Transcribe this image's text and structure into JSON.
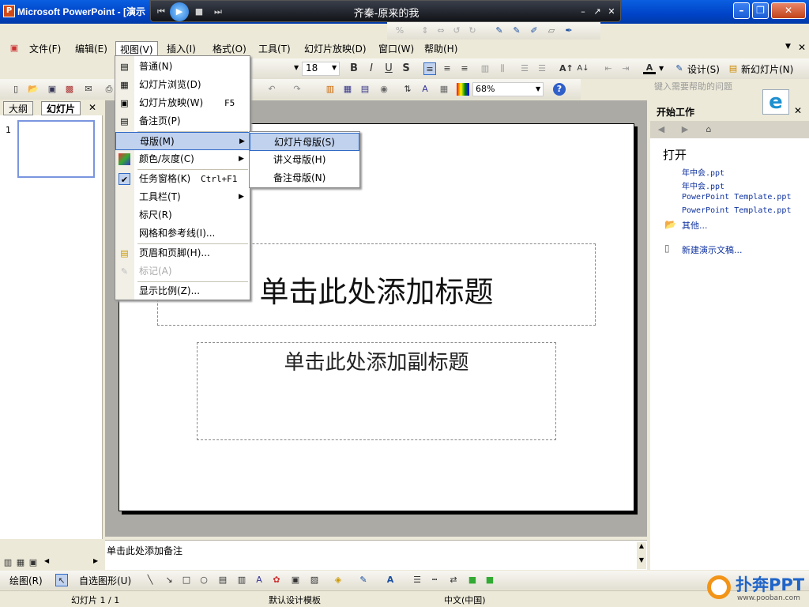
{
  "window": {
    "app_title": "Microsoft PowerPoint - [演示"
  },
  "player": {
    "song": "齐秦-原来的我",
    "prev": "⏮",
    "play": "▶",
    "stop": "■",
    "next": "⏭"
  },
  "title_buttons": {
    "min": "–",
    "restore": "❐",
    "close": "✕"
  },
  "player_buttons": {
    "min": "–",
    "max": "↗",
    "close": "✕"
  },
  "menubar": {
    "items": [
      {
        "label": "文件(F)"
      },
      {
        "label": "编辑(E)"
      },
      {
        "label": "视图(V)"
      },
      {
        "label": "插入(I)"
      },
      {
        "label": "格式(O)"
      },
      {
        "label": "工具(T)"
      },
      {
        "label": "幻灯片放映(D)"
      },
      {
        "label": "窗口(W)"
      },
      {
        "label": "帮助(H)"
      }
    ],
    "help_placeholder": "键入需要帮助的问题",
    "close": "✕"
  },
  "format_toolbar": {
    "font_size": "18",
    "bold": "B",
    "italic": "I",
    "underline": "U",
    "shadow": "S",
    "design_label": "设计(S)",
    "new_slide_label": "新幻灯片(N)"
  },
  "standard_toolbar": {
    "zoom": "68%"
  },
  "tabs": {
    "outline": "大纲",
    "slides": "幻灯片",
    "close": "✕"
  },
  "slides_pane": {
    "slide_number": "1"
  },
  "slide": {
    "title_placeholder": "单击此处添加标题",
    "subtitle_placeholder": "单击此处添加副标题"
  },
  "notes": {
    "placeholder": "单击此处添加备注"
  },
  "task_pane": {
    "title": "开始工作",
    "close": "✕",
    "section_open": "打开",
    "recent_files": [
      "年中会.ppt",
      "年中会.ppt",
      "PowerPoint Template.ppt",
      "PowerPoint Template.ppt"
    ],
    "more": "其他...",
    "new_presentation": "新建演示文稿..."
  },
  "view_menu": {
    "items": [
      {
        "label": "普通(N)",
        "shortcut": "",
        "icon": "normal-view-icon"
      },
      {
        "label": "幻灯片浏览(D)",
        "shortcut": "",
        "icon": "slide-sorter-icon"
      },
      {
        "label": "幻灯片放映(W)",
        "shortcut": "F5",
        "icon": "slideshow-icon"
      },
      {
        "label": "备注页(P)",
        "shortcut": "",
        "icon": "notes-page-icon"
      },
      {
        "label": "母版(M)",
        "shortcut": "",
        "icon": ""
      },
      {
        "label": "颜色/灰度(C)",
        "shortcut": "",
        "icon": "color-gray-icon"
      },
      {
        "label": "任务窗格(K)",
        "shortcut": "Ctrl+F1",
        "icon": "check-icon"
      },
      {
        "label": "工具栏(T)",
        "shortcut": "",
        "icon": ""
      },
      {
        "label": "标尺(R)",
        "shortcut": "",
        "icon": ""
      },
      {
        "label": "网格和参考线(I)...",
        "shortcut": "",
        "icon": ""
      },
      {
        "label": "页眉和页脚(H)...",
        "shortcut": "",
        "icon": "header-footer-icon"
      },
      {
        "label": "标记(A)",
        "shortcut": "",
        "icon": "markup-icon"
      },
      {
        "label": "显示比例(Z)...",
        "shortcut": "",
        "icon": ""
      }
    ]
  },
  "master_submenu": {
    "items": [
      {
        "label": "幻灯片母版(S)"
      },
      {
        "label": "讲义母版(H)"
      },
      {
        "label": "备注母版(N)"
      }
    ]
  },
  "draw_toolbar": {
    "draw_label": "绘图(R)",
    "autoshapes_label": "自选图形(U)"
  },
  "statusbar": {
    "slide_pos": "幻灯片 1 / 1",
    "template": "默认设计模板",
    "language": "中文(中国)"
  },
  "watermark": {
    "brand": "扑奔PPT",
    "url": "www.pooban.com"
  },
  "colors": {
    "titlebar": "#0043c8",
    "menu_highlight": "#c1d2ee",
    "link": "#1033a0",
    "editor_bg": "#abaaa5"
  }
}
